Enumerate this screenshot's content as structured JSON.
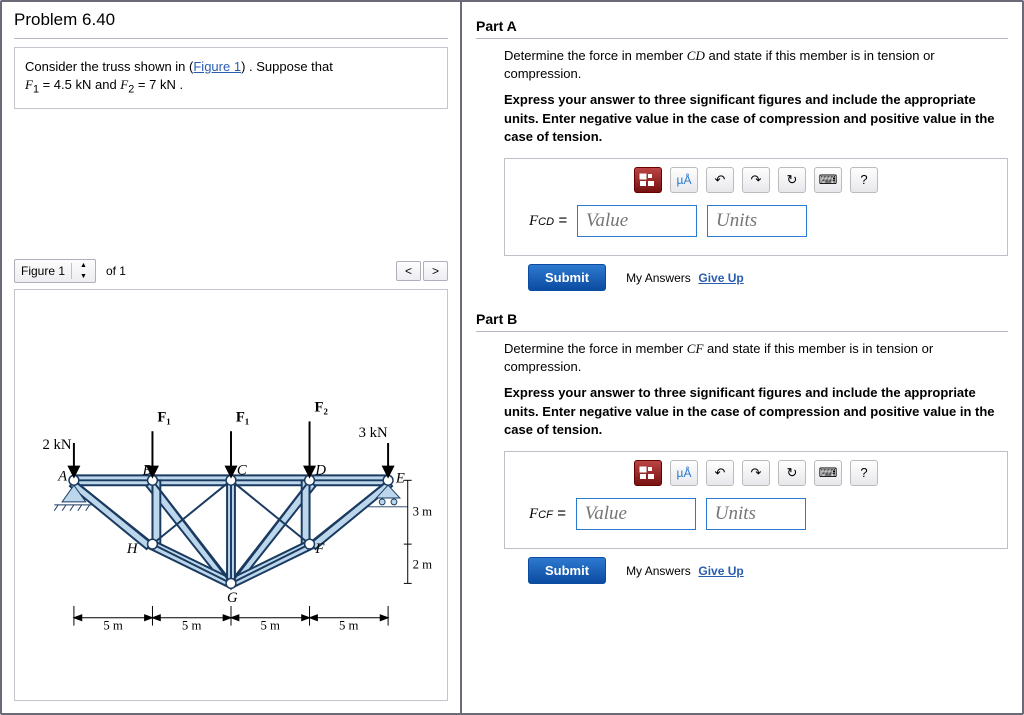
{
  "problem": {
    "title": "Problem 6.40",
    "statement_pre": "Consider the truss shown in (",
    "figure_link": "Figure 1",
    "statement_post": ") . Suppose that",
    "eq1_lhs": "F",
    "eq1_sub": "1",
    "eq1_val": " = 4.5 kN",
    "and": " and ",
    "eq2_lhs": "F",
    "eq2_sub": "2",
    "eq2_val": " = 7 kN",
    "period": " ."
  },
  "figure_nav": {
    "label": "Figure 1",
    "of": "of 1",
    "prev": "<",
    "next": ">"
  },
  "truss": {
    "load_left": "2 kN",
    "load_right": "3 kN",
    "F1a": "F₁",
    "F1b": "F₁",
    "F2": "F₂",
    "A": "A",
    "B": "B",
    "C": "C",
    "D": "D",
    "E": "E",
    "F": "F",
    "G": "G",
    "H": "H",
    "h1": "3 m",
    "h2": "2 m",
    "seg": "5 m"
  },
  "partA": {
    "header": "Part A",
    "desc_pre": "Determine the force in member ",
    "member": "CD",
    "desc_post": " and state if this member is in tension or compression.",
    "instr": "Express your answer to three significant figures and include the appropriate units. Enter negative value in the case of compression and positive value in the case of tension.",
    "force_label": "F",
    "force_sub": "CD",
    "eq": " = ",
    "value_ph": "Value",
    "units_ph": "Units",
    "submit": "Submit",
    "my_answers": "My Answers",
    "give_up": "Give Up"
  },
  "partB": {
    "header": "Part B",
    "desc_pre": "Determine the force in member ",
    "member": "CF",
    "desc_post": " and state if this member is in tension or compression.",
    "instr": "Express your answer to three significant figures and include the appropriate units. Enter negative value in the case of compression and positive value in the case of tension.",
    "force_label": "F",
    "force_sub": "CF",
    "eq": " = ",
    "value_ph": "Value",
    "units_ph": "Units",
    "submit": "Submit",
    "my_answers": "My Answers",
    "give_up": "Give Up"
  },
  "toolbar": {
    "templates": "⎕",
    "ua": "µÅ",
    "undo": "↶",
    "redo": "↷",
    "reset": "↻",
    "keyboard": "⌨",
    "help": "?"
  }
}
